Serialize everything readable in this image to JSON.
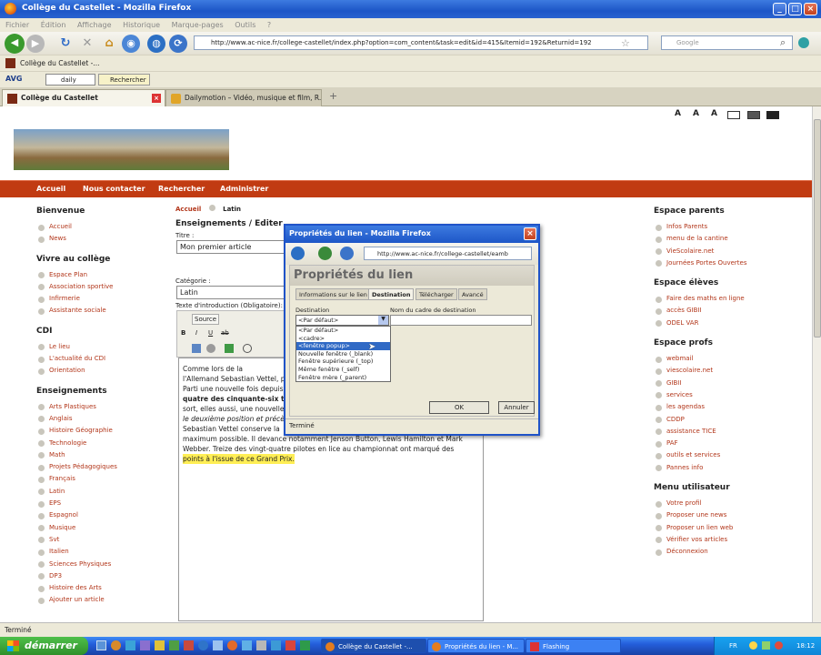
{
  "window": {
    "title": "Collège du Castellet - Mozilla Firefox"
  },
  "menubar": [
    "Fichier",
    "Édition",
    "Affichage",
    "Historique",
    "Marque-pages",
    "Outils",
    "?"
  ],
  "navbar": {
    "url": "http://www.ac-nice.fr/college-castellet/index.php?option=com_content&task=edit&id=415&Itemid=192&Returnid=192",
    "search_placeholder": "Google"
  },
  "bookmarks": {
    "item": "Collège du Castellet -..."
  },
  "avgbar": {
    "logo": "AVG",
    "daily": "daily",
    "search_btn": "Rechercher"
  },
  "tabs": [
    {
      "label": "Collège du Castellet"
    },
    {
      "label": "Dailymotion – Vidéo, musique et film, R..."
    }
  ],
  "site": {
    "font_sizes": [
      "A",
      "A",
      "A"
    ],
    "nav": [
      "Accueil",
      "Nous contacter",
      "Rechercher",
      "Administrer"
    ],
    "breadcrumb": {
      "home": "Accueil",
      "current": "Latin"
    },
    "left": [
      {
        "title": "Bienvenue",
        "items": [
          "Accueil",
          "News"
        ]
      },
      {
        "title": "Vivre au collège",
        "items": [
          "Espace Plan",
          "Association sportive",
          "Infirmerie",
          "Assistante sociale"
        ]
      },
      {
        "title": "CDI",
        "items": [
          "Le lieu",
          "L'actualité du CDI",
          "Orientation"
        ]
      },
      {
        "title": "Enseignements",
        "items": [
          "Arts Plastiques",
          "Anglais",
          "Histoire Géographie",
          "Technologie",
          "Math",
          "Projets Pédagogiques",
          "Français",
          "Latin",
          "EPS",
          "Espagnol",
          "Musique",
          "Svt",
          "Italien",
          "Sciences Physiques",
          "DP3",
          "Histoire des Arts",
          "Ajouter un article"
        ]
      }
    ],
    "right": [
      {
        "title": "Espace parents",
        "items": [
          "Infos Parents",
          "menu de la cantine",
          "VieScolaire.net",
          "Journées Portes Ouvertes"
        ]
      },
      {
        "title": "Espace élèves",
        "items": [
          "Faire des maths en ligne",
          "accès GIBII",
          "ODEL VAR"
        ]
      },
      {
        "title": "Espace profs",
        "items": [
          "webmail",
          "viescolaire.net",
          "GIBII",
          "services",
          "les agendas",
          "CDDP",
          "assistance TICE",
          "PAF",
          "outils et services",
          "Pannes info"
        ]
      },
      {
        "title": "Menu utilisateur",
        "items": [
          "Votre profil",
          "Proposer une news",
          "Proposer un lien web",
          "Vérifier vos articles",
          "Déconnexion"
        ]
      }
    ],
    "editor": {
      "heading": "Enseignements / Editer",
      "title_label": "Titre :",
      "title_value": "Mon premier article",
      "category_label": "Catégorie :",
      "category_value": "Latin",
      "intro_label": "Texte d'introduction (Obligatoire):",
      "source_btn": "Source",
      "body_lines": [
        "Comme lors de la",
        "l'Allemand Sebastian Vettel, p",
        "Parti une nouvelle fois depuis",
        "quatre des cinquante-six tour",
        "sort, elles aussi, une nouvelle",
        "le deuxième position et précè",
        "Sebastian Vettel conserve la",
        "maximum possible. Il devance notamment Jenson Button, Lewis Hamilton et Mark",
        "Webber. Treize des vingt-quatre pilotes en lice au championnat ont marqué des"
      ],
      "highlight_line": "points à l'issue de ce Grand Prix."
    }
  },
  "dialog": {
    "title": "Propriétés du lien - Mozilla Firefox",
    "url": "http://www.ac-nice.fr/college-castellet/eamb",
    "heading": "Propriétés du lien",
    "tabs": [
      "Informations sur le lien",
      "Destination",
      "Télécharger",
      "Avancé"
    ],
    "dest_label": "Destination",
    "dest_value": "<Par défaut>",
    "frame_label": "Nom du cadre de destination",
    "options": [
      "<Par défaut>",
      "<cadre>",
      "<fenêtre popup>",
      "Nouvelle fenêtre (_blank)",
      "Fenêtre supérieure (_top)",
      "Même fenêtre (_self)",
      "Fenêtre mère (_parent)"
    ],
    "ok": "OK",
    "cancel": "Annuler",
    "status": "Terminé"
  },
  "status": "Terminé",
  "taskbar": {
    "start": "démarrer",
    "items": [
      "Collège du Castellet -...",
      "Propriétés du lien - M...",
      "Flashing"
    ],
    "lang": "FR",
    "clock": "18:12"
  },
  "colors": {
    "accent": "#c13b12",
    "link": "#b2361a",
    "xp_blue": "#245edb"
  }
}
